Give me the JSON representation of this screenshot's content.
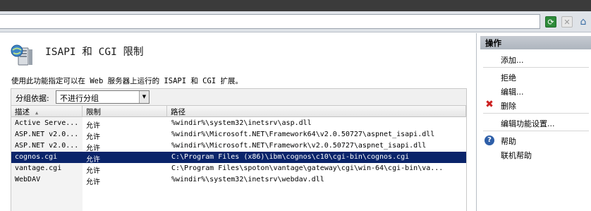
{
  "toolbar": {
    "icons": [
      "refresh-icon",
      "stop-icon",
      "home-icon"
    ]
  },
  "page": {
    "title": "ISAPI 和 CGI 限制",
    "description": "使用此功能指定可以在 Web 服务器上运行的 ISAPI 和 CGI 扩展。"
  },
  "groupby": {
    "label": "分组依据:",
    "value": "不进行分组"
  },
  "table": {
    "columns": [
      "描述",
      "限制",
      "路径"
    ],
    "rows": [
      {
        "desc": "Active Serve...",
        "limit": "允许",
        "path": "%windir%\\system32\\inetsrv\\asp.dll"
      },
      {
        "desc": "ASP.NET v2.0...",
        "limit": "允许",
        "path": "%windir%\\Microsoft.NET\\Framework64\\v2.0.50727\\aspnet_isapi.dll"
      },
      {
        "desc": "ASP.NET v2.0...",
        "limit": "允许",
        "path": "%windir%\\Microsoft.NET\\Framework\\v2.0.50727\\aspnet_isapi.dll"
      },
      {
        "desc": "cognos.cgi",
        "limit": "允许",
        "path": "C:\\Program Files (x86)\\ibm\\cognos\\c10\\cgi-bin\\cognos.cgi"
      },
      {
        "desc": "vantage.cgi",
        "limit": "允许",
        "path": "C:\\Program Files\\spoton\\vantage\\gateway\\cgi\\win-64\\cgi-bin\\va..."
      },
      {
        "desc": "WebDAV",
        "limit": "允许",
        "path": "%windir%\\system32\\inetsrv\\webdav.dll"
      }
    ],
    "selected_row": 3
  },
  "actions": {
    "header": "操作",
    "add": "添加...",
    "deny": "拒绝",
    "edit": "编辑...",
    "delete": "删除",
    "edit_settings": "编辑功能设置...",
    "help": "帮助",
    "online_help": "联机帮助"
  },
  "colors": {
    "selection": "#0a246a",
    "actions_header": "#b8bec6",
    "delete_red": "#cc1f1f",
    "help_blue": "#2e5fa8"
  }
}
